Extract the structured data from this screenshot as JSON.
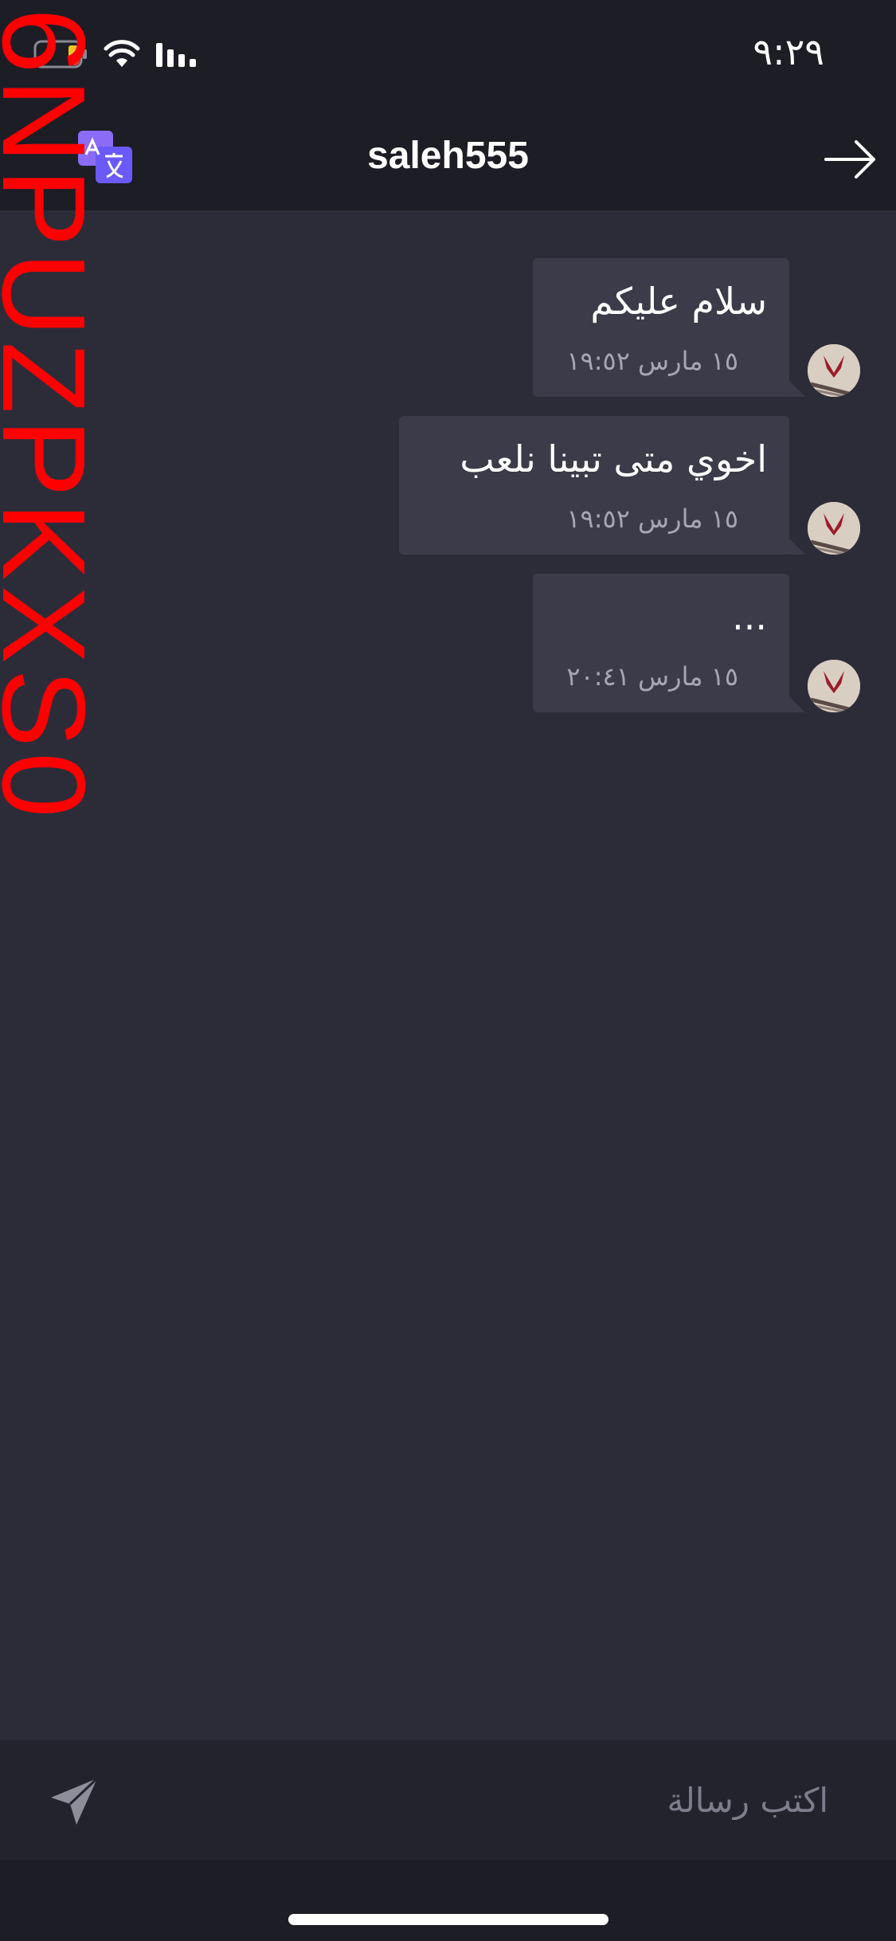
{
  "status_bar": {
    "time": "٩:٢٩",
    "icons": [
      "battery-icon",
      "wifi-icon",
      "signal-icon"
    ]
  },
  "header": {
    "title": "saleh555",
    "icons": [
      "translate-icon",
      "back-arrow-icon"
    ]
  },
  "watermark": "6NPUZPKXS0",
  "messages": [
    {
      "text": "سلام عليكم",
      "time": "١٥ مارس ١٩:٥٢"
    },
    {
      "text": "اخوي متى تبينا نلعب",
      "time": "١٥ مارس ١٩:٥٢"
    },
    {
      "text": "...",
      "time": "١٥ مارس ٢٠:٤١"
    }
  ],
  "composer": {
    "placeholder": "اكتب رسالة",
    "value": ""
  },
  "colors": {
    "background": "#2c2c39",
    "bar": "#1d1d26",
    "bubble": "#3b3b49",
    "accent_translate": "#6a5af9",
    "watermark": "#ff0000"
  }
}
